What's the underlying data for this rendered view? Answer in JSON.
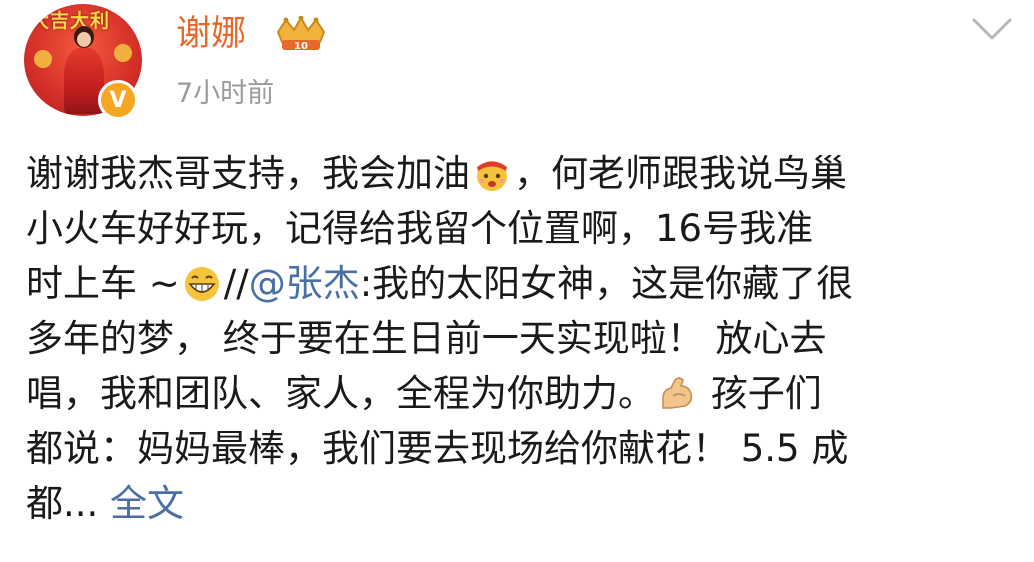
{
  "post": {
    "user": {
      "name": "谢娜",
      "time": "7小时前",
      "avatar_banner": "大吉大利",
      "verified_mark": "V",
      "badge_number": "10"
    },
    "content": {
      "l1_a": "谢谢我杰哥支持，我会加油",
      "l1_b": "，何老师跟我说鸟巢",
      "l2": "小火车好好玩，记得给我留个位置啊，16号我准",
      "l3_a": "时上车 ~",
      "l3_b": "//",
      "l3_mention": "@张杰",
      "l3_c": ":我的太阳女神，这是你藏了很",
      "l4": "多年的梦， 终于要在生日前一天实现啦！ 放心去",
      "l5_a": "唱，我和团队、家人，全程为你助力。",
      "l5_b": " 孩子们",
      "l6": "都说：妈妈最棒，我们要去现场给你献花！ 5.5 成",
      "l7_a": "都... ",
      "l7_full": "全文"
    },
    "icons": {
      "emoji1": "cheer-emoji-icon",
      "emoji2": "grin-emoji-icon",
      "emoji3": "flex-muscle-icon",
      "menu": "chevron-down-icon",
      "badge": "crown-badge-icon"
    },
    "colors": {
      "name": "#e8682a",
      "link": "#4a6fa5",
      "time": "#9b9b9b",
      "text": "#1a1a1a",
      "verified": "#f5a623"
    }
  }
}
